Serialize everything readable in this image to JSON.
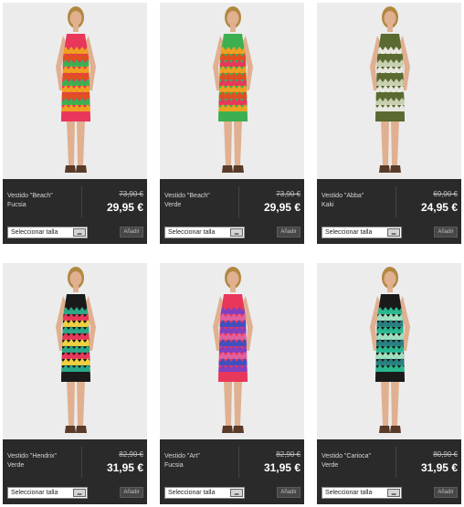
{
  "products": [
    {
      "name": "Vestido \"Beach\"",
      "color": "Fucsia",
      "old_price": "73,90 €",
      "price": "29,95 €",
      "size_select": "Seleccionar talla",
      "add_label": "Añadir"
    },
    {
      "name": "Vestido \"Beach\"",
      "color": "Verde",
      "old_price": "73,90 €",
      "price": "29,95 €",
      "size_select": "Seleccionar talla",
      "add_label": "Añadir"
    },
    {
      "name": "Vestido \"Abba\"",
      "color": "Kaki",
      "old_price": "69,90 €",
      "price": "24,95 €",
      "size_select": "Seleccionar talla",
      "add_label": "Añadir"
    },
    {
      "name": "Vestido \"Hendrix\"",
      "color": "Verde",
      "old_price": "82,90 €",
      "price": "31,95 €",
      "size_select": "Seleccionar talla",
      "add_label": "Añadir"
    },
    {
      "name": "Vestido \"Art\"",
      "color": "Fucsia",
      "old_price": "82,90 €",
      "price": "31,95 €",
      "size_select": "Seleccionar talla",
      "add_label": "Añadir"
    },
    {
      "name": "Vestido \"Carioca\"",
      "color": "Verde",
      "old_price": "80,90 €",
      "price": "31,95 €",
      "size_select": "Seleccionar talla",
      "add_label": "Añadir"
    }
  ],
  "colors": {
    "card_bg": "#2a2a2a",
    "photo_bg": "#ececec",
    "price": "#ffffff",
    "old_price": "#bdbdbd",
    "text": "#d7d7d7"
  },
  "dress_palettes": [
    [
      "#e8375a",
      "#f0a020",
      "#e05020",
      "#3cb050"
    ],
    [
      "#3cb050",
      "#f0a020",
      "#e05020",
      "#e8375a"
    ],
    [
      "#5a6a30",
      "#e8e8e0",
      "#5a6a30",
      "#c8d0b0"
    ],
    [
      "#1a1a1a",
      "#2aa888",
      "#e8375a",
      "#f0d040"
    ],
    [
      "#e8375a",
      "#8040c0",
      "#e060a0",
      "#4050c0"
    ],
    [
      "#1a1a1a",
      "#2ab890",
      "#a0e0c0",
      "#2a8080"
    ]
  ]
}
